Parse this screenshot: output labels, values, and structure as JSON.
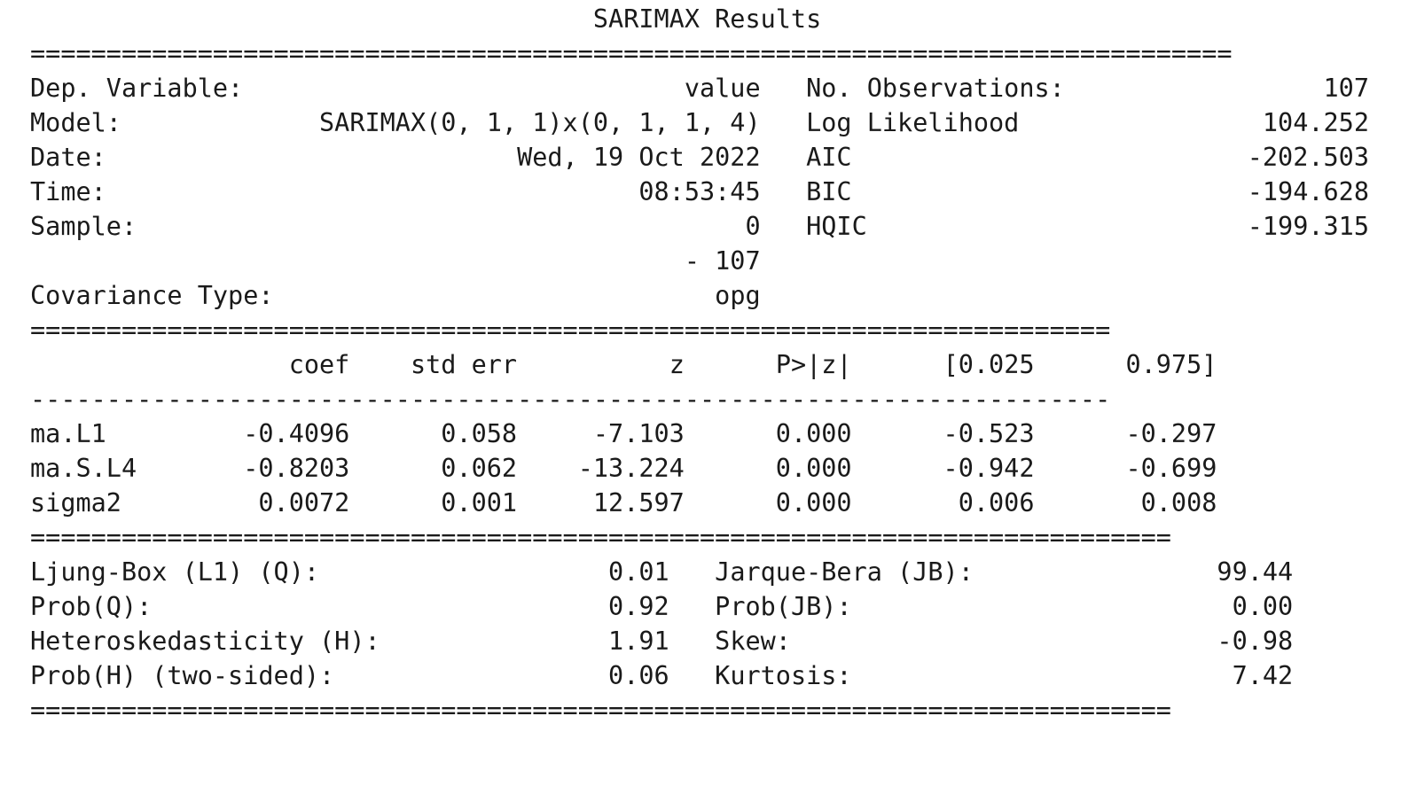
{
  "title": "SARIMAX Results",
  "separators": {
    "full": "===============================================================================",
    "coef": "=======================================================================",
    "coef_dash": "-----------------------------------------------------------------------",
    "diag": "==========================================================================="
  },
  "model_info": {
    "left": [
      {
        "label": "Dep. Variable:",
        "value": "value"
      },
      {
        "label": "Model:",
        "value": "SARIMAX(0, 1, 1)x(0, 1, 1, 4)"
      },
      {
        "label": "Date:",
        "value": "Wed, 19 Oct 2022"
      },
      {
        "label": "Time:",
        "value": "08:53:45"
      },
      {
        "label": "Sample:",
        "value": "0"
      },
      {
        "label": "",
        "value": "- 107"
      },
      {
        "label": "Covariance Type:",
        "value": "opg"
      }
    ],
    "right": [
      {
        "label": "No. Observations:",
        "value": "107"
      },
      {
        "label": "Log Likelihood",
        "value": "104.252"
      },
      {
        "label": "AIC",
        "value": "-202.503"
      },
      {
        "label": "BIC",
        "value": "-194.628"
      },
      {
        "label": "HQIC",
        "value": "-199.315"
      }
    ]
  },
  "coef_table": {
    "columns": [
      "coef",
      "std err",
      "z",
      "P>|z|",
      "[0.025",
      "0.975]"
    ],
    "rows": [
      {
        "name": "ma.L1",
        "values": [
          "-0.4096",
          "0.058",
          "-7.103",
          "0.000",
          "-0.523",
          "-0.297"
        ]
      },
      {
        "name": "ma.S.L4",
        "values": [
          "-0.8203",
          "0.062",
          "-13.224",
          "0.000",
          "-0.942",
          "-0.699"
        ]
      },
      {
        "name": "sigma2",
        "values": [
          "0.0072",
          "0.001",
          "12.597",
          "0.000",
          "0.006",
          "0.008"
        ]
      }
    ]
  },
  "diagnostics": {
    "left": [
      {
        "label": "Ljung-Box (L1) (Q):",
        "value": "0.01"
      },
      {
        "label": "Prob(Q):",
        "value": "0.92"
      },
      {
        "label": "Heteroskedasticity (H):",
        "value": "1.91"
      },
      {
        "label": "Prob(H) (two-sided):",
        "value": "0.06"
      }
    ],
    "right": [
      {
        "label": "Jarque-Bera (JB):",
        "value": "99.44"
      },
      {
        "label": "Prob(JB):",
        "value": "0.00"
      },
      {
        "label": "Skew:",
        "value": "-0.98"
      },
      {
        "label": "Kurtosis:",
        "value": "7.42"
      }
    ]
  }
}
